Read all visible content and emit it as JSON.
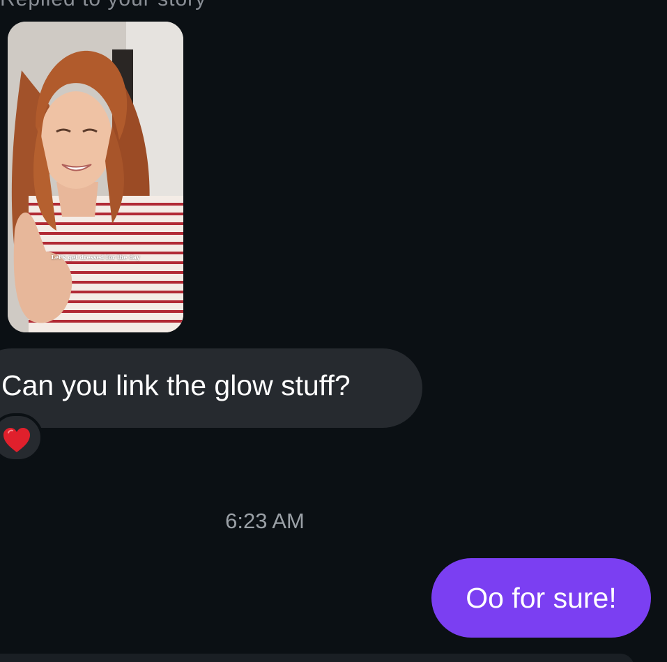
{
  "conversation": {
    "replied_header": "Replied to your story",
    "story": {
      "caption": "Let's get dressed for the day"
    },
    "incoming_message": {
      "text": "Can you link the glow stuff?",
      "reaction_icon": "red-heart-icon"
    },
    "timestamp": "6:23 AM",
    "outgoing_message": {
      "text": "Oo for sure!"
    }
  },
  "colors": {
    "background": "#0b1014",
    "incoming_bubble": "#262a2f",
    "outgoing_bubble": "#7b3ff2",
    "timestamp_text": "#9aa0a6",
    "reaction_heart": "#e0202c"
  }
}
